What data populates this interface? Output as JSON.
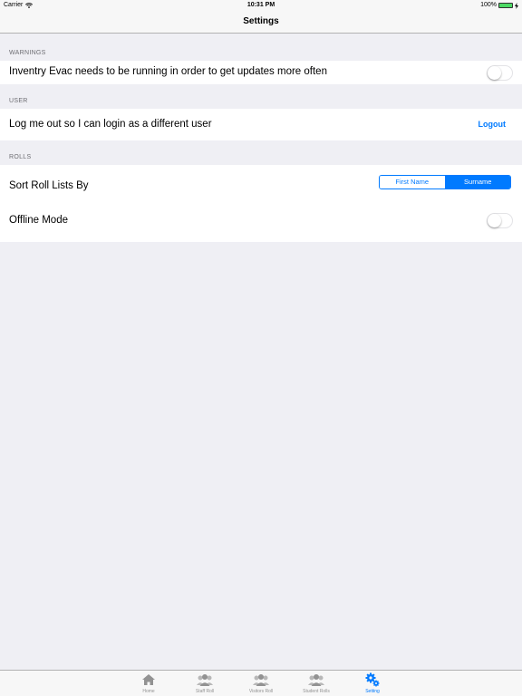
{
  "status_bar": {
    "carrier": "Carrier",
    "time": "10:31 PM",
    "battery": "100%"
  },
  "nav": {
    "title": "Settings"
  },
  "sections": {
    "warnings": {
      "header": "WARNINGS",
      "updates_label": "Inventry Evac needs to be running in order to get updates more often",
      "updates_on": false
    },
    "user": {
      "header": "USER",
      "logout_text": "Log me out so I can login as a different user",
      "logout_button": "Logout"
    },
    "rolls": {
      "header": "ROLLS",
      "sort_label": "Sort Roll Lists By",
      "sort_options": [
        "First Name",
        "Surname"
      ],
      "sort_selected": "Surname",
      "offline_label": "Offline Mode",
      "offline_on": false
    }
  },
  "tab_bar": {
    "items": [
      {
        "label": "Home",
        "icon": "house-icon"
      },
      {
        "label": "Staff Roll",
        "icon": "people-icon"
      },
      {
        "label": "Visitors Roll",
        "icon": "people-icon"
      },
      {
        "label": "Student Rolls",
        "icon": "people-icon"
      },
      {
        "label": "Setting",
        "icon": "gears-icon"
      }
    ],
    "active": "Setting"
  },
  "colors": {
    "accent": "#007aff",
    "background": "#efeff4",
    "battery": "#4cd964"
  }
}
